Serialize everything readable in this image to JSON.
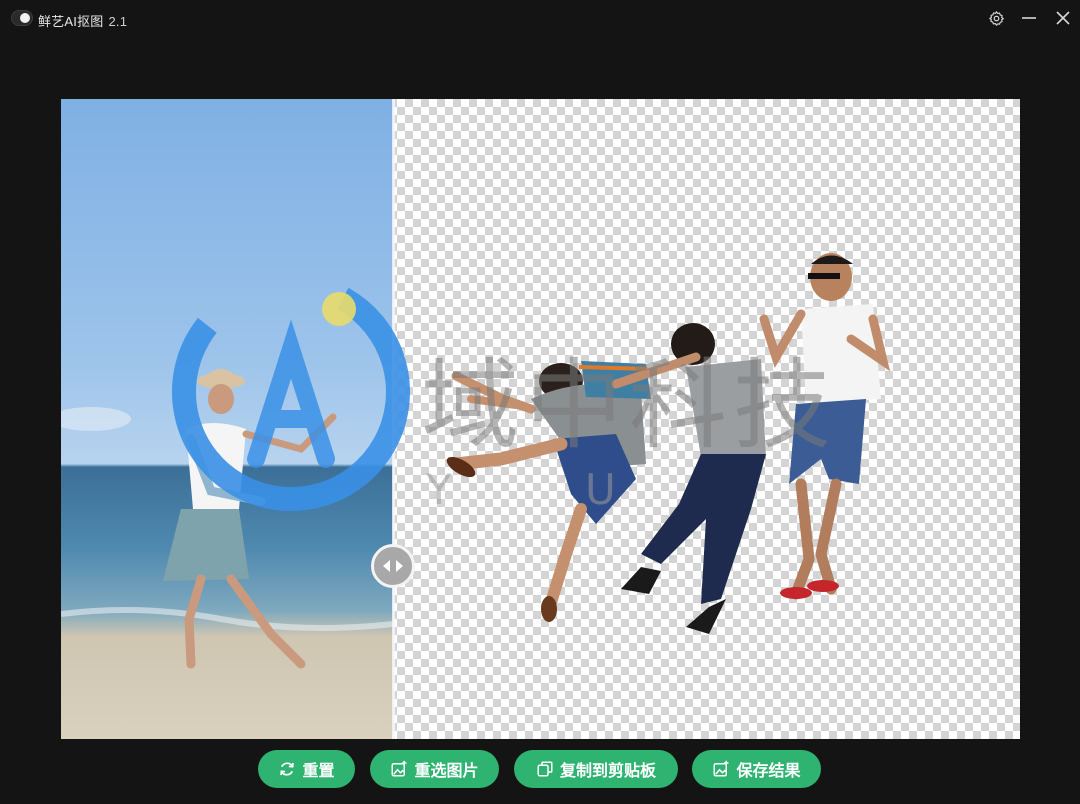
{
  "app": {
    "title": "鲜艺AI抠图",
    "version": "2.1"
  },
  "window_controls": [
    "gear-icon",
    "minimize-icon",
    "close-icon"
  ],
  "watermark": {
    "text": "域中科技",
    "letters": "Y U",
    "logo": "AI"
  },
  "toolbar": {
    "reset_label": "重置",
    "reselect_label": "重选图片",
    "copy_label": "复制到剪贴板",
    "save_label": "保存结果"
  },
  "colors": {
    "accent": "#2fb371",
    "background": "#141414"
  }
}
